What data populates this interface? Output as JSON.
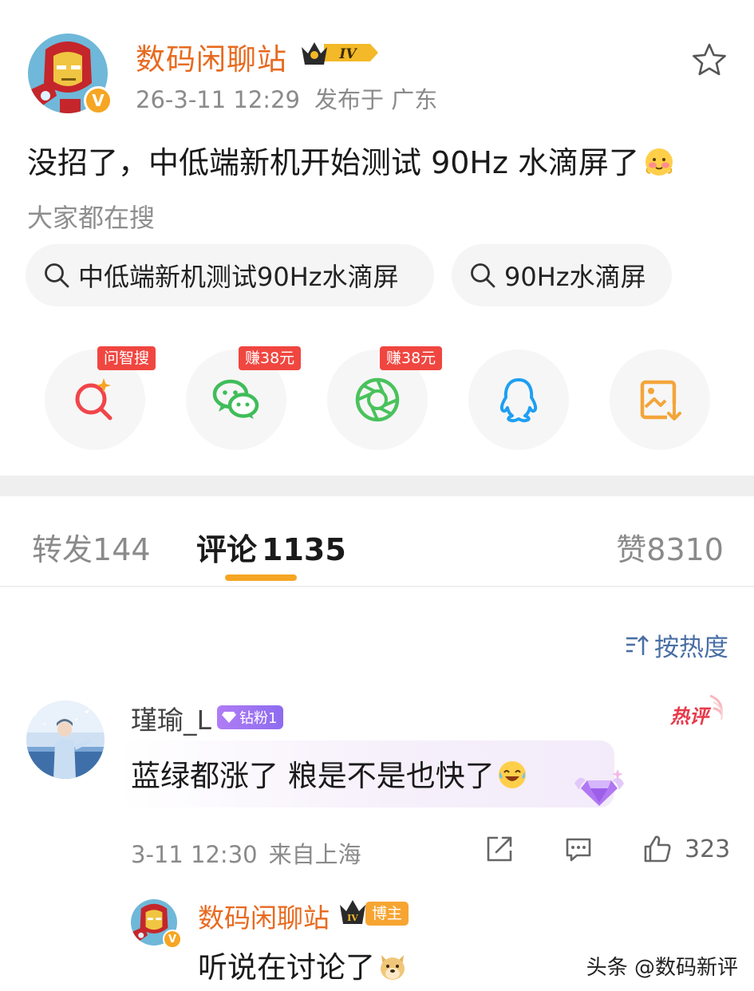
{
  "post": {
    "author": "数码闲聊站",
    "level": "IV",
    "verified_mark": "V",
    "time": "26-3-11 12:29",
    "location": "发布于 广东",
    "text": "没招了，中低端新机开始测试 90Hz 水滴屏了",
    "text_emoji": "blush-emoji"
  },
  "search": {
    "label": "大家都在搜",
    "chips": [
      "中低端新机测试90Hz水滴屏",
      "90Hz水滴屏"
    ]
  },
  "share": [
    {
      "name": "ai-search",
      "tag": "问智搜",
      "icon": "ai-search-icon",
      "color": "#f0454a"
    },
    {
      "name": "wechat",
      "tag": "赚38元",
      "icon": "wechat-icon",
      "color": "#3fbd59"
    },
    {
      "name": "moments",
      "tag": "赚38元",
      "icon": "moments-icon",
      "color": "#49c25c"
    },
    {
      "name": "qq",
      "tag": "",
      "icon": "qq-icon",
      "color": "#1e9ff2"
    },
    {
      "name": "save-image",
      "tag": "",
      "icon": "save-image-icon",
      "color": "#f3a53a"
    }
  ],
  "tabs": {
    "repost": "转发",
    "repost_count": "144",
    "comment": "评论",
    "comment_count": "1135",
    "like": "赞",
    "like_count": "8310"
  },
  "sort": {
    "label": "按热度"
  },
  "comment": {
    "user": "瑾瑜_L",
    "fan_badge": "钻粉1",
    "hot_label": "热评",
    "text": "蓝绿都涨了 粮是不是也快了",
    "time": "3-11 12:30",
    "location": "来自上海",
    "likes": "323"
  },
  "reply": {
    "user": "数码闲聊站",
    "role": "博主",
    "level": "IV",
    "verified_mark": "V",
    "text": "听说在讨论了"
  },
  "watermark": "头条 @数码新评",
  "colors": {
    "accent": "#f5a623",
    "author": "#e86a1f",
    "link": "#4a6fa5"
  }
}
